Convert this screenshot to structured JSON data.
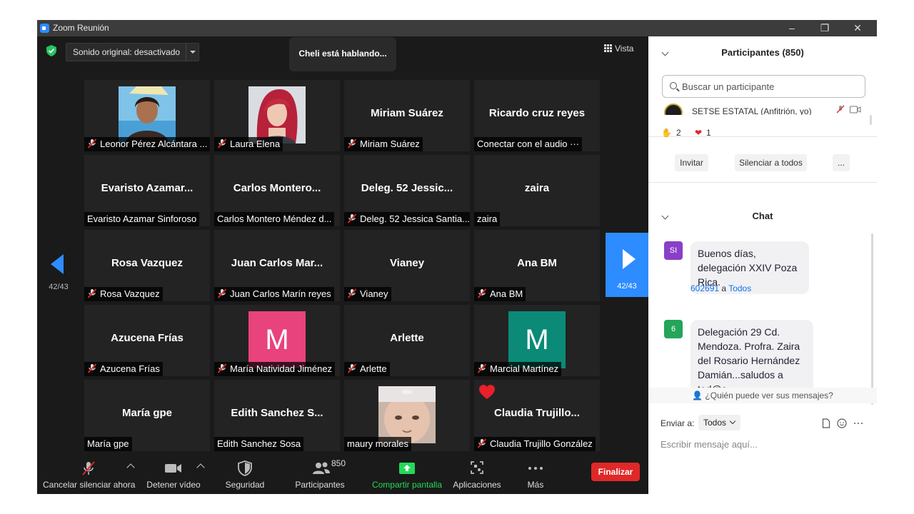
{
  "window": {
    "title": "Zoom Reunión",
    "minimize": "–",
    "restore": "❐",
    "close": "✕"
  },
  "top": {
    "sound_dropdown": "Sonido original: desactivado",
    "speaking": "Cheli está hablando...",
    "view_label": "Vista"
  },
  "nav": {
    "left_page": "42/43",
    "right_page": "42/43"
  },
  "tiles": [
    {
      "display": "",
      "label": "Leonor Pérez Alcántara ...",
      "muted": true,
      "kind": "photo1"
    },
    {
      "display": "",
      "label": "Laura Elena",
      "muted": true,
      "kind": "photo2"
    },
    {
      "display": "Miriam Suárez",
      "label": "Miriam Suárez",
      "muted": true,
      "kind": "name"
    },
    {
      "display": "Ricardo cruz reyes",
      "label": "Conectar con el audio ···",
      "muted": false,
      "kind": "name"
    },
    {
      "display": "Evaristo  Azamar...",
      "label": "Evaristo Azamar Sinforoso",
      "muted": false,
      "kind": "name"
    },
    {
      "display": "Carlos  Montero...",
      "label": "Carlos Montero  Méndez d...",
      "muted": false,
      "kind": "name"
    },
    {
      "display": "Deleg. 52  Jessic...",
      "label": "Deleg. 52 Jessica Santia...",
      "muted": true,
      "kind": "name"
    },
    {
      "display": "zaira",
      "label": "zaira",
      "muted": false,
      "kind": "name"
    },
    {
      "display": "Rosa Vazquez",
      "label": "Rosa Vazquez",
      "muted": true,
      "kind": "name"
    },
    {
      "display": "Juan  Carlos  Mar...",
      "label": "Juan Carlos Marín reyes",
      "muted": true,
      "kind": "name"
    },
    {
      "display": "Vianey",
      "label": "Vianey",
      "muted": true,
      "kind": "name"
    },
    {
      "display": "Ana BM",
      "label": "Ana BM",
      "muted": true,
      "kind": "name"
    },
    {
      "display": "Azucena Frías",
      "label": "Azucena Frías",
      "muted": true,
      "kind": "name"
    },
    {
      "display": "M",
      "label": "María Natividad Jiménez",
      "muted": true,
      "kind": "avatar",
      "color": "#e8437c"
    },
    {
      "display": "Arlette",
      "label": "Arlette",
      "muted": true,
      "kind": "name"
    },
    {
      "display": "M",
      "label": "Marcial Martínez",
      "muted": true,
      "kind": "avatar",
      "color": "#0b8a77"
    },
    {
      "display": "María gpe",
      "label": "María gpe",
      "muted": false,
      "kind": "name"
    },
    {
      "display": "Edith  Sanchez  S...",
      "label": "Edith Sanchez Sosa",
      "muted": false,
      "kind": "name"
    },
    {
      "display": "",
      "label": "maury morales",
      "muted": false,
      "kind": "photo3"
    },
    {
      "display": "Claudia  Trujillo...",
      "label": "Claudia Trujillo González",
      "muted": true,
      "kind": "name",
      "heart": true
    }
  ],
  "toolbar": {
    "unmute": "Cancelar silenciar ahora",
    "video": "Detener vídeo",
    "security": "Seguridad",
    "participants": "Participantes",
    "participants_count": "850",
    "share": "Compartir pantalla",
    "apps": "Aplicaciones",
    "more": "Más",
    "end": "Finalizar"
  },
  "participants_panel": {
    "title": "Participantes (850)",
    "search_placeholder": "Buscar un participante",
    "host_row": "SETSE ESTATAL (Anfitrión, yo)",
    "raise_hand_count": "2",
    "heart_count": "1",
    "invite": "Invitar",
    "mute_all": "Silenciar a todos",
    "more": "..."
  },
  "chat": {
    "title": "Chat",
    "messages": [
      {
        "avatar": "SI",
        "avatar_color": "#8a3fc7",
        "text": "Buenos días, delegación XXIV Poza Rica."
      },
      {
        "avatar": "6",
        "avatar_color": "#23a55a",
        "sender": "602691",
        "to_word": "a",
        "to": "Todos",
        "text": "Delegación 29 Cd. Mendoza. Profra. Zaira del Rosario Hernández Damián...saludos a tod@s"
      }
    ],
    "who_can_see": "¿Quién puede ver sus mensajes?",
    "send_to_label": "Enviar a:",
    "send_to_value": "Todos",
    "input_placeholder": "Escribir mensaje aquí..."
  },
  "colors": {
    "accent": "#2d8cff",
    "end": "#e02828",
    "share": "#23d959"
  }
}
